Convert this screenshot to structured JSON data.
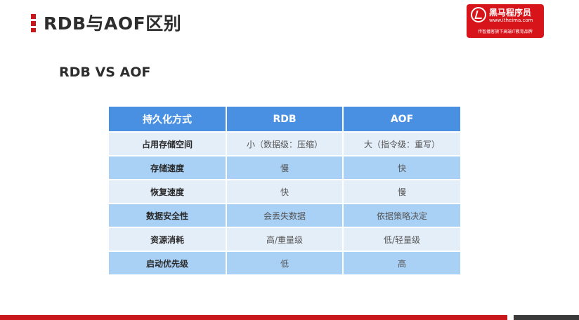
{
  "slide": {
    "title": "RDB与AOF区别",
    "subtitle": "RDB VS AOF"
  },
  "logo": {
    "name": "黑马程序员",
    "url": "www.itheima.com",
    "slogan": "传智播客旗下高端IT教育品牌"
  },
  "table": {
    "headers": [
      "持久化方式",
      "RDB",
      "AOF"
    ],
    "rows": [
      [
        "占用存储空间",
        "小（数据级：压缩）",
        "大（指令级：重写）"
      ],
      [
        "存储速度",
        "慢",
        "快"
      ],
      [
        "恢复速度",
        "快",
        "慢"
      ],
      [
        "数据安全性",
        "会丢失数据",
        "依据策略决定"
      ],
      [
        "资源消耗",
        "高/重量级",
        "低/轻量级"
      ],
      [
        "启动优先级",
        "低",
        "高"
      ]
    ]
  },
  "colors": {
    "brand_red": "#c8161d",
    "header_blue": "#4a90e2",
    "row_light": "#e4eef9",
    "row_blue": "#a9d0f5"
  }
}
